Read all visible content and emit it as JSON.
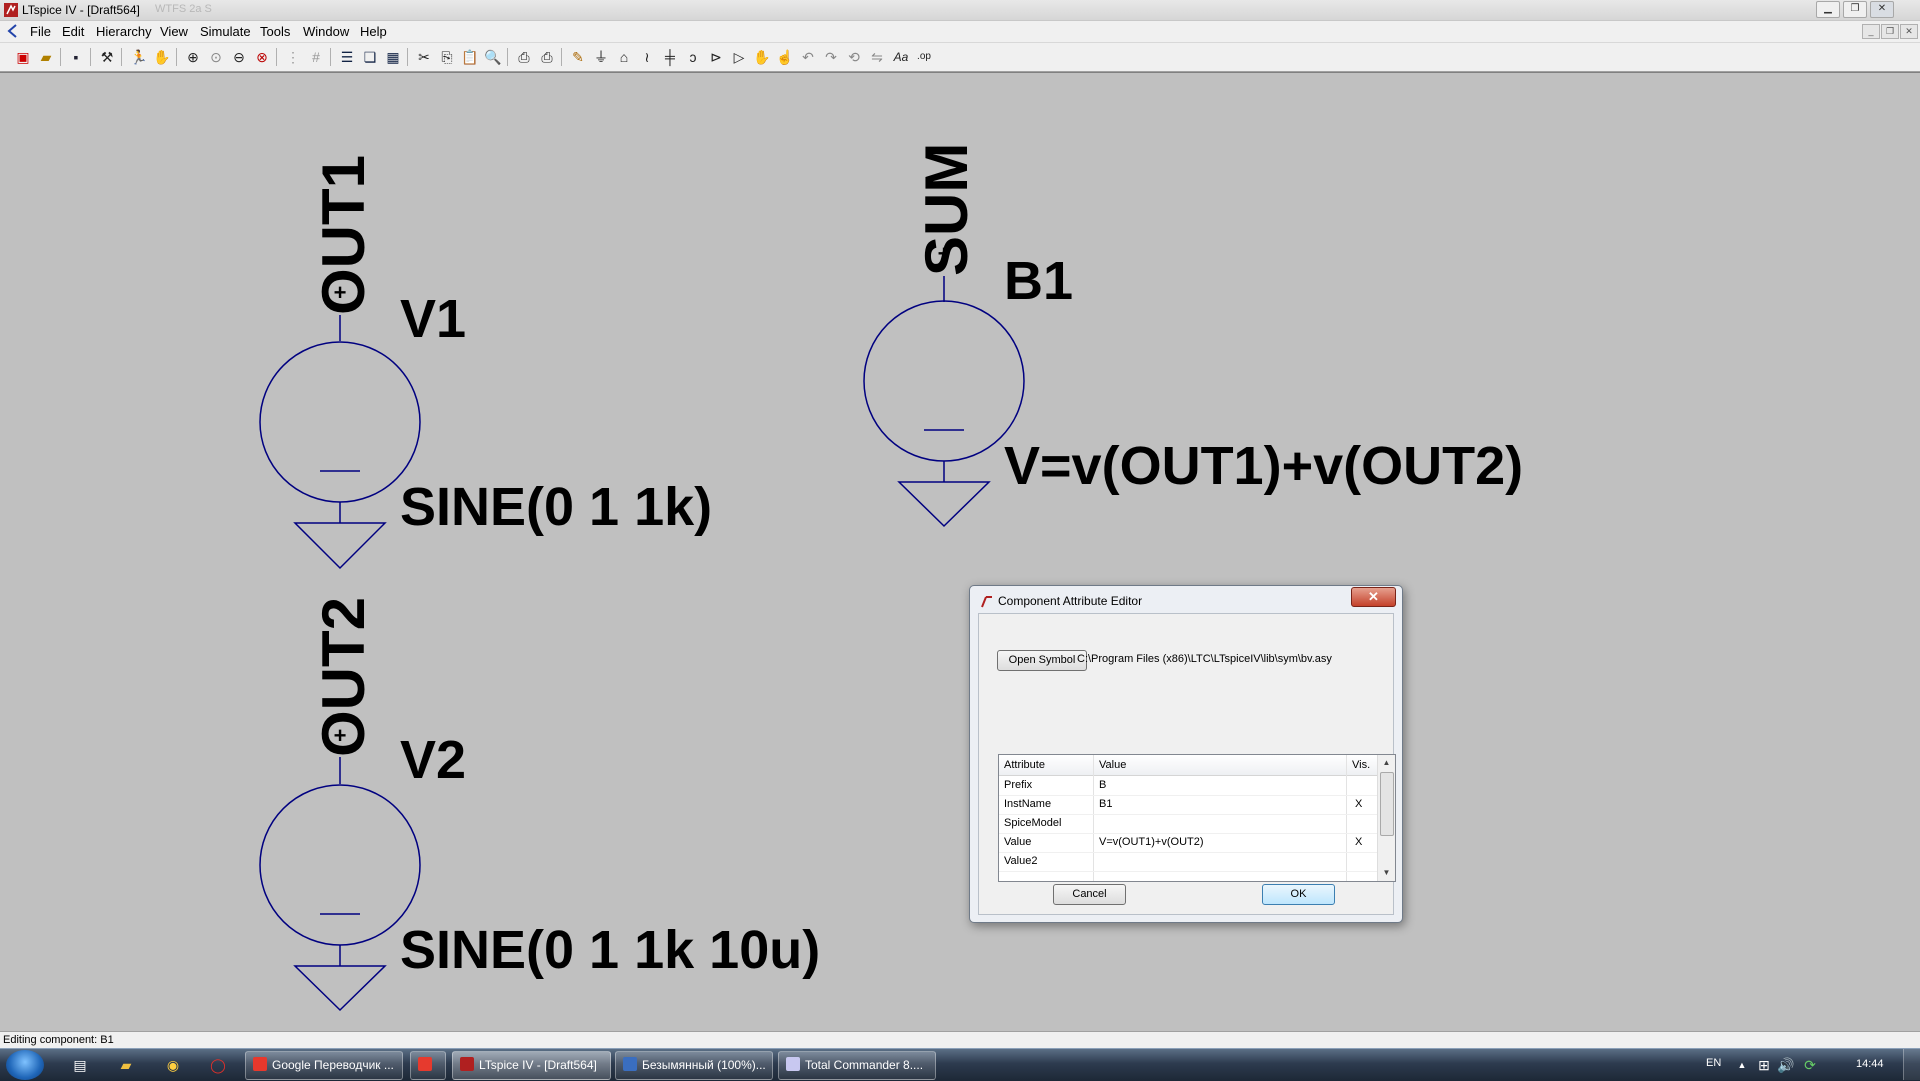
{
  "window": {
    "title": "LTspice IV - [Draft564]",
    "ghost_text": "WTFS 2a S"
  },
  "menu": {
    "items": [
      "File",
      "Edit",
      "Hierarchy",
      "View",
      "Simulate",
      "Tools",
      "Window",
      "Help"
    ]
  },
  "toolbar": {
    "icons": [
      "new-schematic-icon",
      "open-icon",
      "save-icon",
      "control-panel-icon",
      "run-icon",
      "halt-icon",
      "zoom-in-icon",
      "zoom-pan-icon",
      "zoom-out-icon",
      "zoom-fit-icon",
      "autorange-icon",
      "grid-icon",
      "tile-horizontal-icon",
      "cascade-icon",
      "tile-icon",
      "cut-icon",
      "copy-icon",
      "paste-icon",
      "find-icon",
      "print-setup-icon",
      "print-icon",
      "draw-wire-icon",
      "ground-icon",
      "label-net-icon",
      "resistor-icon",
      "capacitor-icon",
      "inductor-icon",
      "diode-icon",
      "component-icon",
      "move-icon",
      "drag-icon",
      "undo-icon",
      "redo-icon",
      "rotate-icon",
      "mirror-icon",
      "text-icon",
      "spice-directive-icon"
    ],
    "text_tool_label": "Aa",
    "directive_label": ".op"
  },
  "schematic": {
    "v1_net": "OUT1",
    "v1_name": "V1",
    "v1_value": "SINE(0 1 1k)",
    "v2_net": "OUT2",
    "v2_name": "V2",
    "v2_value": "SINE(0 1 1k 10u)",
    "b1_net": "SUM",
    "b1_name": "B1",
    "b1_value": "V=v(OUT1)+v(OUT2)",
    "plus": "+",
    "wire_color": "#000080"
  },
  "dialog": {
    "title": "Component Attribute Editor",
    "close_label": "✕",
    "open_symbol_label": "Open Symbol",
    "symbol_path": "C:\\Program Files (x86)\\LTC\\LTspiceIV\\lib\\sym\\bv.asy",
    "columns": [
      "Attribute",
      "Value",
      "Vis."
    ],
    "rows": [
      {
        "attribute": "Prefix",
        "value": "B",
        "vis": ""
      },
      {
        "attribute": "InstName",
        "value": "B1",
        "vis": "X"
      },
      {
        "attribute": "SpiceModel",
        "value": "",
        "vis": ""
      },
      {
        "attribute": "Value",
        "value": "V=v(OUT1)+v(OUT2)",
        "vis": "X"
      },
      {
        "attribute": "Value2",
        "value": "",
        "vis": ""
      }
    ],
    "cancel_label": "Cancel",
    "ok_label": "OK"
  },
  "status": {
    "text": "Editing component: B1"
  },
  "taskbar": {
    "tasks": [
      {
        "label": "Google Переводчик ...",
        "icon_color": "#e8382c",
        "active": false
      },
      {
        "label": "",
        "icon_color": "#e63a2e",
        "active": false
      },
      {
        "label": "LTspice IV - [Draft564]",
        "icon_color": "#b02020",
        "active": true
      },
      {
        "label": "Безымянный (100%)...",
        "icon_color": "#3a6ec0",
        "active": false
      },
      {
        "label": "Total Commander 8....",
        "icon_color": "#c8c8f0",
        "active": false
      }
    ],
    "lang": "EN",
    "clock": "14:44"
  }
}
